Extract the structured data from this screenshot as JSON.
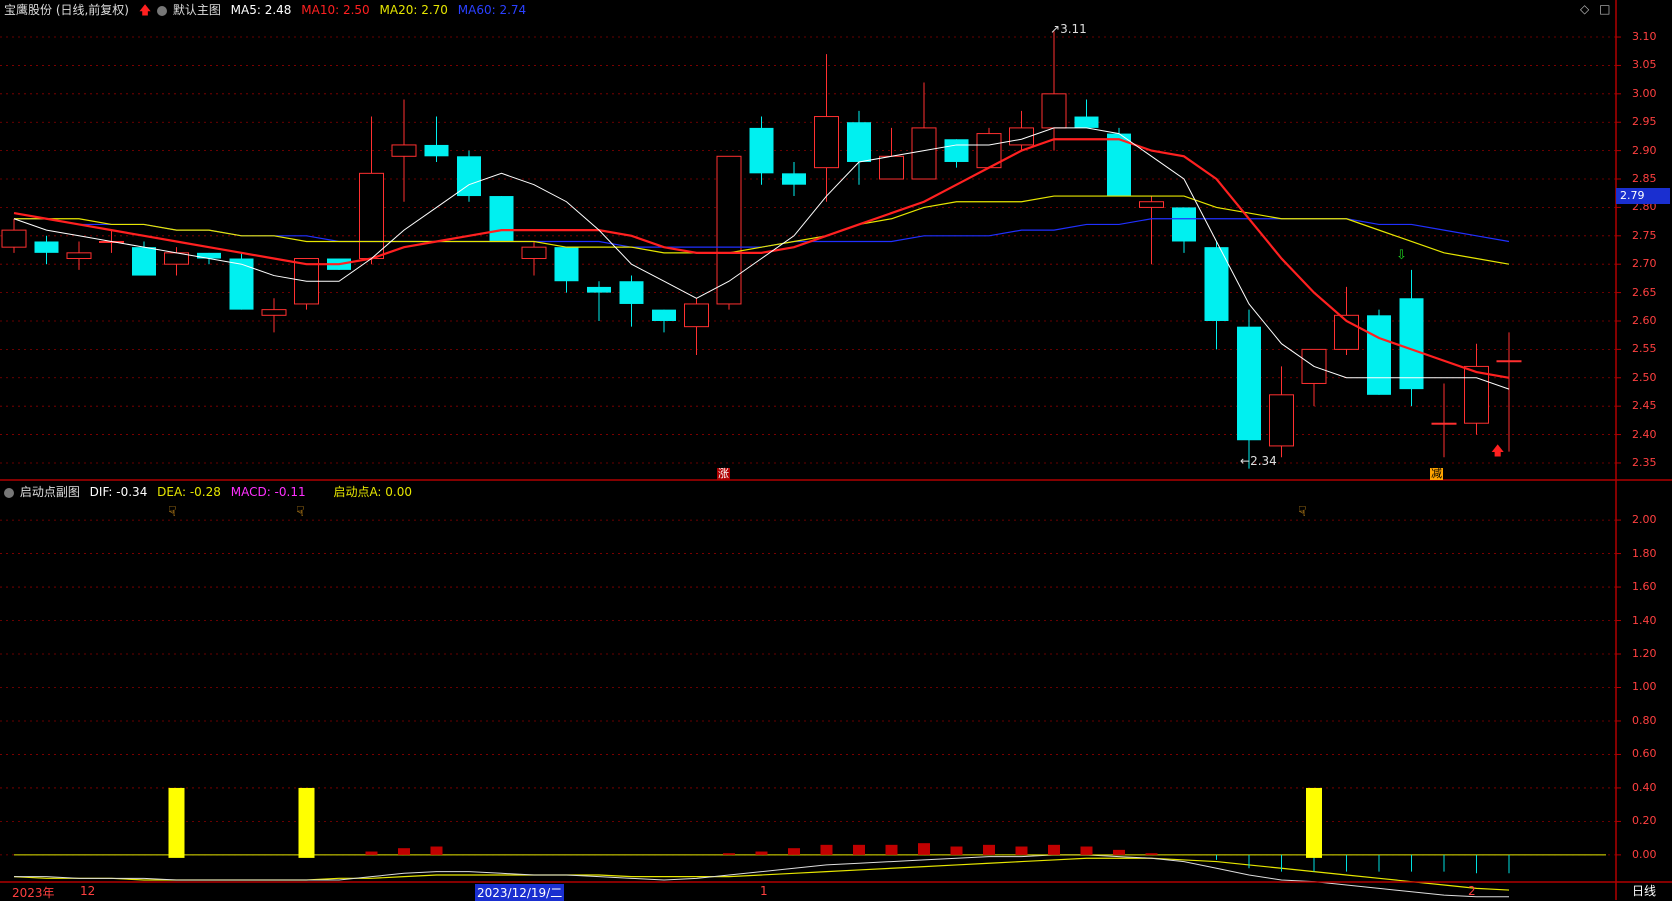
{
  "main_header": {
    "title": "宝鹰股份 (日线,前复权)",
    "chart_name": "默认主图",
    "ma5": "MA5: 2.48",
    "ma10": "MA10: 2.50",
    "ma20": "MA20: 2.70",
    "ma60": "MA60: 2.74"
  },
  "sub_header": {
    "chart_name": "启动点副图",
    "dif": "DIF: -0.34",
    "dea": "DEA: -0.28",
    "macd": "MACD: -0.11",
    "start_a": "启动点A: 0.00"
  },
  "price_axis": [
    "3.10",
    "3.05",
    "3.00",
    "2.95",
    "2.90",
    "2.85",
    "2.80",
    "2.75",
    "2.70",
    "2.65",
    "2.60",
    "2.55",
    "2.50",
    "2.45",
    "2.40",
    "2.35"
  ],
  "current_price": "2.79",
  "sub_axis": [
    "2.00",
    "1.80",
    "1.60",
    "1.40",
    "1.20",
    "1.00",
    "0.80",
    "0.60",
    "0.40",
    "0.20",
    "0.00"
  ],
  "annotations": {
    "high": "3.11",
    "low": "2.34",
    "zhang": "涨",
    "jian": "减"
  },
  "date_axis": {
    "year": "2023年",
    "m12": "12",
    "cursor_date": "2023/12/19/二",
    "m1": "1",
    "m2": "2"
  },
  "period": "日线",
  "colors": {
    "up": "#ff3030",
    "down": "#00f0f0",
    "ma5": "#ffffff",
    "ma10": "#ff2020",
    "ma20": "#e6e600",
    "ma60": "#2030ff",
    "grid": "#8b0000"
  },
  "chart_data": {
    "type": "candlestick",
    "price_range": [
      2.32,
      3.13
    ],
    "candles": [
      {
        "o": 2.73,
        "h": 2.78,
        "l": 2.72,
        "c": 2.76
      },
      {
        "o": 2.74,
        "h": 2.75,
        "l": 2.7,
        "c": 2.72
      },
      {
        "o": 2.71,
        "h": 2.74,
        "l": 2.69,
        "c": 2.72
      },
      {
        "o": 2.74,
        "h": 2.76,
        "l": 2.72,
        "c": 2.74
      },
      {
        "o": 2.73,
        "h": 2.74,
        "l": 2.68,
        "c": 2.68
      },
      {
        "o": 2.7,
        "h": 2.73,
        "l": 2.68,
        "c": 2.72
      },
      {
        "o": 2.72,
        "h": 2.72,
        "l": 2.7,
        "c": 2.71
      },
      {
        "o": 2.71,
        "h": 2.72,
        "l": 2.62,
        "c": 2.62
      },
      {
        "o": 2.61,
        "h": 2.64,
        "l": 2.58,
        "c": 2.62
      },
      {
        "o": 2.63,
        "h": 2.71,
        "l": 2.62,
        "c": 2.71
      },
      {
        "o": 2.71,
        "h": 2.71,
        "l": 2.69,
        "c": 2.69
      },
      {
        "o": 2.71,
        "h": 2.96,
        "l": 2.7,
        "c": 2.86
      },
      {
        "o": 2.89,
        "h": 2.99,
        "l": 2.81,
        "c": 2.91
      },
      {
        "o": 2.91,
        "h": 2.96,
        "l": 2.88,
        "c": 2.89
      },
      {
        "o": 2.89,
        "h": 2.9,
        "l": 2.81,
        "c": 2.82
      },
      {
        "o": 2.82,
        "h": 2.82,
        "l": 2.74,
        "c": 2.74
      },
      {
        "o": 2.71,
        "h": 2.74,
        "l": 2.68,
        "c": 2.73
      },
      {
        "o": 2.73,
        "h": 2.73,
        "l": 2.65,
        "c": 2.67
      },
      {
        "o": 2.66,
        "h": 2.67,
        "l": 2.6,
        "c": 2.65
      },
      {
        "o": 2.67,
        "h": 2.68,
        "l": 2.59,
        "c": 2.63
      },
      {
        "o": 2.62,
        "h": 2.62,
        "l": 2.58,
        "c": 2.6
      },
      {
        "o": 2.59,
        "h": 2.64,
        "l": 2.54,
        "c": 2.63
      },
      {
        "o": 2.63,
        "h": 2.89,
        "l": 2.62,
        "c": 2.89
      },
      {
        "o": 2.94,
        "h": 2.96,
        "l": 2.84,
        "c": 2.86
      },
      {
        "o": 2.86,
        "h": 2.88,
        "l": 2.82,
        "c": 2.84
      },
      {
        "o": 2.87,
        "h": 3.07,
        "l": 2.81,
        "c": 2.96
      },
      {
        "o": 2.95,
        "h": 2.97,
        "l": 2.84,
        "c": 2.88
      },
      {
        "o": 2.85,
        "h": 2.94,
        "l": 2.85,
        "c": 2.89
      },
      {
        "o": 2.85,
        "h": 3.02,
        "l": 2.85,
        "c": 2.94
      },
      {
        "o": 2.92,
        "h": 2.92,
        "l": 2.87,
        "c": 2.88
      },
      {
        "o": 2.87,
        "h": 2.94,
        "l": 2.87,
        "c": 2.93
      },
      {
        "o": 2.91,
        "h": 2.97,
        "l": 2.9,
        "c": 2.94
      },
      {
        "o": 2.94,
        "h": 3.11,
        "l": 2.9,
        "c": 3.0
      },
      {
        "o": 2.96,
        "h": 2.99,
        "l": 2.94,
        "c": 2.94
      },
      {
        "o": 2.93,
        "h": 2.94,
        "l": 2.82,
        "c": 2.82
      },
      {
        "o": 2.8,
        "h": 2.82,
        "l": 2.7,
        "c": 2.81
      },
      {
        "o": 2.8,
        "h": 2.8,
        "l": 2.72,
        "c": 2.74
      },
      {
        "o": 2.73,
        "h": 2.74,
        "l": 2.55,
        "c": 2.6
      },
      {
        "o": 2.59,
        "h": 2.62,
        "l": 2.34,
        "c": 2.39
      },
      {
        "o": 2.38,
        "h": 2.52,
        "l": 2.36,
        "c": 2.47
      },
      {
        "o": 2.49,
        "h": 2.55,
        "l": 2.45,
        "c": 2.55
      },
      {
        "o": 2.55,
        "h": 2.66,
        "l": 2.54,
        "c": 2.61
      },
      {
        "o": 2.61,
        "h": 2.62,
        "l": 2.47,
        "c": 2.47
      },
      {
        "o": 2.64,
        "h": 2.69,
        "l": 2.45,
        "c": 2.48
      },
      {
        "o": 2.42,
        "h": 2.49,
        "l": 2.36,
        "c": 2.42
      },
      {
        "o": 2.42,
        "h": 2.56,
        "l": 2.4,
        "c": 2.52
      },
      {
        "o": 2.53,
        "h": 2.58,
        "l": 2.37,
        "c": 2.53
      }
    ],
    "ma5": [
      2.78,
      2.76,
      2.75,
      2.74,
      2.73,
      2.72,
      2.71,
      2.7,
      2.68,
      2.67,
      2.67,
      2.71,
      2.76,
      2.8,
      2.84,
      2.86,
      2.84,
      2.81,
      2.76,
      2.7,
      2.67,
      2.64,
      2.67,
      2.71,
      2.75,
      2.82,
      2.88,
      2.89,
      2.9,
      2.91,
      2.91,
      2.92,
      2.94,
      2.94,
      2.93,
      2.89,
      2.85,
      2.74,
      2.63,
      2.56,
      2.52,
      2.5,
      2.5,
      2.5,
      2.5,
      2.5,
      2.48
    ],
    "ma10": [
      2.79,
      2.78,
      2.77,
      2.76,
      2.75,
      2.74,
      2.73,
      2.72,
      2.71,
      2.7,
      2.7,
      2.71,
      2.73,
      2.74,
      2.75,
      2.76,
      2.76,
      2.76,
      2.76,
      2.75,
      2.73,
      2.72,
      2.72,
      2.72,
      2.73,
      2.75,
      2.77,
      2.79,
      2.81,
      2.84,
      2.87,
      2.9,
      2.92,
      2.92,
      2.92,
      2.9,
      2.89,
      2.85,
      2.78,
      2.71,
      2.65,
      2.6,
      2.57,
      2.55,
      2.53,
      2.51,
      2.5
    ],
    "ma20": [
      2.78,
      2.78,
      2.78,
      2.77,
      2.77,
      2.76,
      2.76,
      2.75,
      2.75,
      2.74,
      2.74,
      2.74,
      2.74,
      2.74,
      2.74,
      2.74,
      2.74,
      2.73,
      2.73,
      2.73,
      2.72,
      2.72,
      2.72,
      2.73,
      2.74,
      2.75,
      2.77,
      2.78,
      2.8,
      2.81,
      2.81,
      2.81,
      2.82,
      2.82,
      2.82,
      2.82,
      2.82,
      2.8,
      2.79,
      2.78,
      2.78,
      2.78,
      2.76,
      2.74,
      2.72,
      2.71,
      2.7
    ],
    "ma60": [
      2.78,
      2.78,
      2.77,
      2.77,
      2.77,
      2.76,
      2.76,
      2.75,
      2.75,
      2.75,
      2.74,
      2.74,
      2.74,
      2.74,
      2.74,
      2.74,
      2.74,
      2.74,
      2.74,
      2.73,
      2.73,
      2.73,
      2.73,
      2.73,
      2.74,
      2.74,
      2.74,
      2.74,
      2.75,
      2.75,
      2.75,
      2.76,
      2.76,
      2.77,
      2.77,
      2.78,
      2.78,
      2.78,
      2.78,
      2.78,
      2.78,
      2.78,
      2.77,
      2.77,
      2.76,
      2.75,
      2.74
    ],
    "sub_range": [
      -0.15,
      2.12
    ],
    "start_bars": [
      {
        "index": 5,
        "value": 0.4
      },
      {
        "index": 9,
        "value": 0.4
      },
      {
        "index": 40,
        "value": 0.4
      }
    ],
    "macd_hist": [
      0.0,
      0.0,
      0.0,
      0.0,
      0.0,
      0.0,
      0.0,
      0.0,
      0.0,
      0.0,
      0.0,
      0.02,
      0.04,
      0.05,
      0.0,
      0.0,
      0.0,
      0.0,
      0.0,
      0.0,
      0.0,
      0.0,
      0.01,
      0.02,
      0.04,
      0.06,
      0.06,
      0.06,
      0.07,
      0.05,
      0.06,
      0.05,
      0.06,
      0.05,
      0.03,
      0.01,
      0.0,
      -0.03,
      -0.08,
      -0.1,
      -0.1,
      -0.1,
      -0.1,
      -0.1,
      -0.1,
      -0.11,
      -0.11
    ],
    "dif": [
      -0.13,
      -0.13,
      -0.14,
      -0.14,
      -0.14,
      -0.15,
      -0.15,
      -0.15,
      -0.15,
      -0.15,
      -0.15,
      -0.13,
      -0.11,
      -0.1,
      -0.1,
      -0.11,
      -0.12,
      -0.12,
      -0.13,
      -0.14,
      -0.15,
      -0.14,
      -0.12,
      -0.1,
      -0.08,
      -0.06,
      -0.05,
      -0.04,
      -0.03,
      -0.02,
      -0.01,
      -0.01,
      0.0,
      0.0,
      -0.01,
      -0.02,
      -0.04,
      -0.08,
      -0.12,
      -0.15,
      -0.16,
      -0.18,
      -0.2,
      -0.22,
      -0.24,
      -0.25,
      -0.25
    ],
    "dea": [
      -0.13,
      -0.14,
      -0.14,
      -0.14,
      -0.15,
      -0.15,
      -0.15,
      -0.15,
      -0.15,
      -0.15,
      -0.14,
      -0.14,
      -0.13,
      -0.12,
      -0.12,
      -0.12,
      -0.12,
      -0.12,
      -0.12,
      -0.13,
      -0.13,
      -0.13,
      -0.13,
      -0.12,
      -0.11,
      -0.1,
      -0.09,
      -0.08,
      -0.07,
      -0.06,
      -0.05,
      -0.04,
      -0.03,
      -0.02,
      -0.02,
      -0.02,
      -0.03,
      -0.04,
      -0.06,
      -0.08,
      -0.1,
      -0.12,
      -0.14,
      -0.16,
      -0.18,
      -0.2,
      -0.21
    ]
  }
}
